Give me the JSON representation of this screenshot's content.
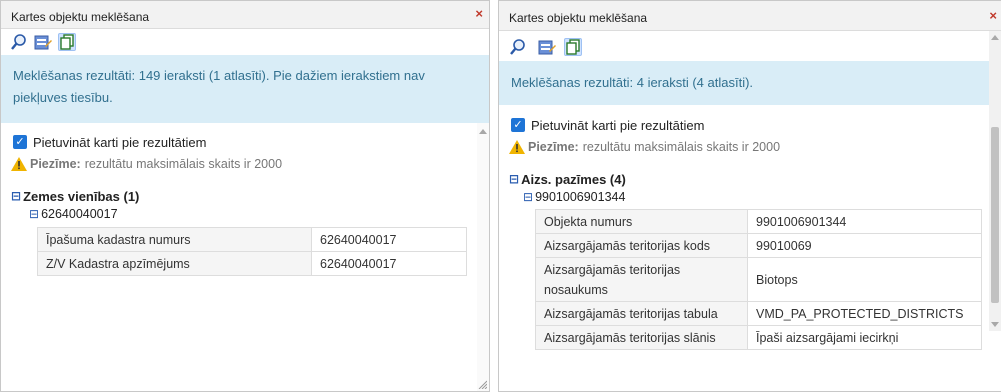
{
  "left": {
    "title": "Kartes objektu meklēšana",
    "close": "×",
    "banner": "Meklēšanas rezultāti: 149 ieraksti (1 atlasīti). Pie dažiem ierakstiem nav piekļuves tiesību.",
    "zoom_label": "Pietuvināt karti pie rezultātiem",
    "note_bold": "Piezīme:",
    "note_text": "rezultātu maksimālais skaits ir 2000",
    "group": "Zemes vienības (1)",
    "item": "62640040017",
    "rows": [
      {
        "key": "Īpašuma kadastra numurs",
        "value": "62640040017"
      },
      {
        "key": "Z/V Kadastra apzīmējums",
        "value": "62640040017"
      }
    ]
  },
  "right": {
    "title": "Kartes objektu meklēšana",
    "close": "×",
    "banner": "Meklēšanas rezultāti: 4 ieraksti (4 atlasīti).",
    "zoom_label": "Pietuvināt karti pie rezultātiem",
    "note_bold": "Piezīme:",
    "note_text": "rezultātu maksimālais skaits ir 2000",
    "group": "Aizs. pazīmes (4)",
    "item": "9901006901344",
    "rows": [
      {
        "key": "Objekta numurs",
        "value": "9901006901344"
      },
      {
        "key": "Aizsargājamās teritorijas kods",
        "value": "99010069"
      },
      {
        "key": "Aizsargājamās teritorijas nosaukums",
        "value": "Biotops"
      },
      {
        "key": "Aizsargājamās teritorijas tabula",
        "value": "VMD_PA_PROTECTED_DISTRICTS"
      },
      {
        "key": "Aizsargājamās teritorijas slānis",
        "value": "Īpaši aizsargājami iecirkņi"
      }
    ]
  },
  "toggle_symbol": "⊟",
  "check_symbol": "✓",
  "colors": {
    "banner_bg": "#d9edf7",
    "banner_text": "#31708f",
    "checkbox": "#1e74d6",
    "close": "#c0392b"
  }
}
